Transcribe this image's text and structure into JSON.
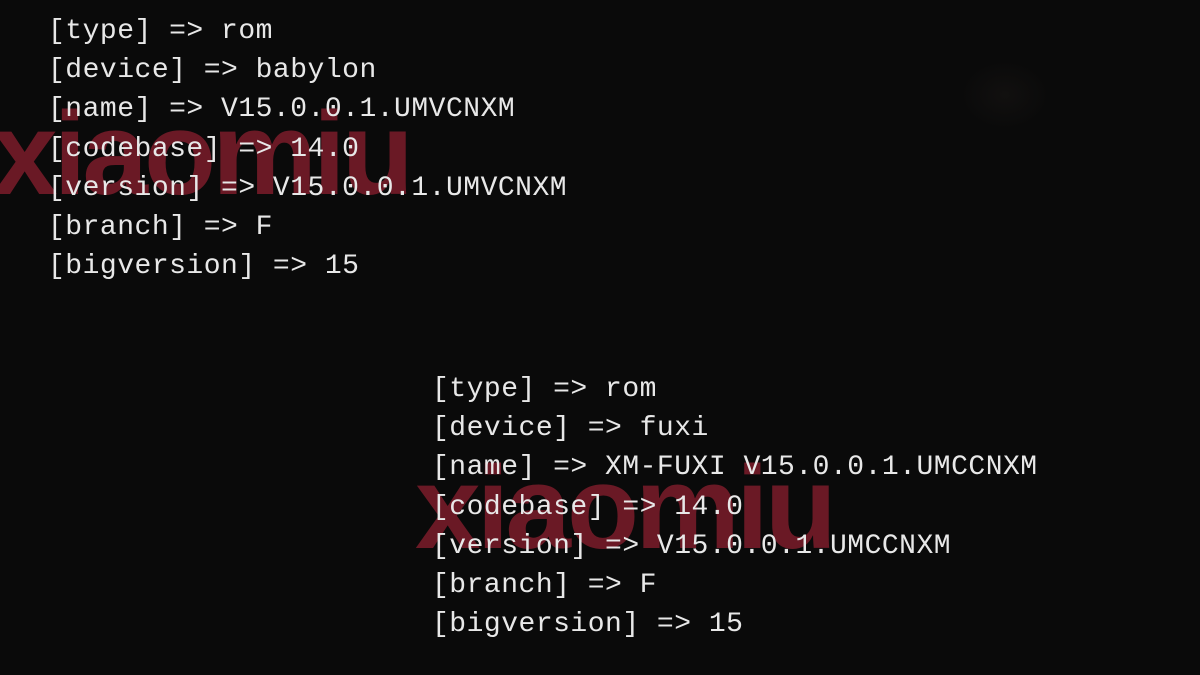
{
  "watermark": {
    "top": "xiaomiu",
    "bottom": "xiaomiu"
  },
  "blocks": {
    "top": {
      "lines": [
        "[type] => rom",
        "[device] => babylon",
        "[name] => V15.0.0.1.UMVCNXM",
        "[codebase] => 14.0",
        "[version] => V15.0.0.1.UMVCNXM",
        "[branch] => F",
        "[bigversion] => 15"
      ]
    },
    "bottom": {
      "lines": [
        "[type] => rom",
        "[device] => fuxi",
        "[name] => XM-FUXI V15.0.0.1.UMCCNXM",
        "[codebase] => 14.0",
        "[version] => V15.0.0.1.UMCCNXM",
        "[branch] => F",
        "[bigversion] => 15"
      ]
    }
  }
}
